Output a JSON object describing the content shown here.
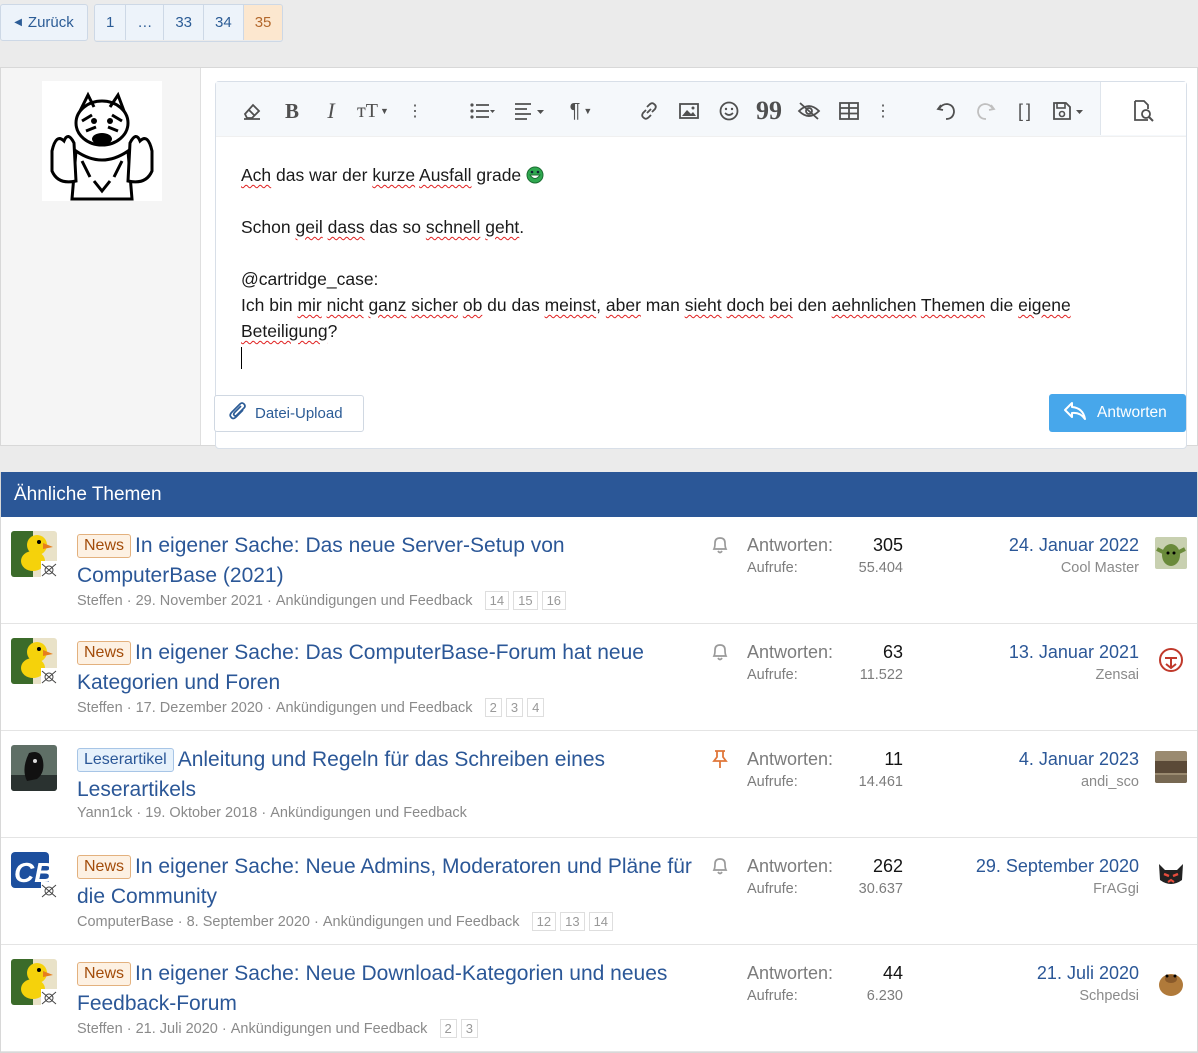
{
  "pagination": {
    "back_label": "Zurück",
    "pages": [
      "1",
      "…",
      "33",
      "34",
      "35"
    ],
    "current": "35"
  },
  "editor": {
    "lines": [
      {
        "words": [
          {
            "t": "Ach",
            "sq": true
          },
          {
            "t": " das war der "
          },
          {
            "t": "kurze",
            "sq": true
          },
          {
            "t": " "
          },
          {
            "t": "Ausfall",
            "sq": true
          },
          {
            "t": " grade "
          }
        ],
        "emoji": true
      },
      {
        "words": []
      },
      {
        "words": [
          {
            "t": "Schon "
          },
          {
            "t": "geil",
            "sq": true
          },
          {
            "t": " "
          },
          {
            "t": "dass",
            "sq": true
          },
          {
            "t": " das so "
          },
          {
            "t": "schnell",
            "sq": true
          },
          {
            "t": " "
          },
          {
            "t": "geht",
            "sq": true
          },
          {
            "t": "."
          }
        ]
      },
      {
        "words": []
      },
      {
        "words": [
          {
            "t": "@cartridge_case:"
          }
        ]
      },
      {
        "words": [
          {
            "t": "Ich bin "
          },
          {
            "t": "mir",
            "sq": true
          },
          {
            "t": " "
          },
          {
            "t": "nicht",
            "sq": true
          },
          {
            "t": " "
          },
          {
            "t": "ganz",
            "sq": true
          },
          {
            "t": " "
          },
          {
            "t": "sicher",
            "sq": true
          },
          {
            "t": " "
          },
          {
            "t": "ob",
            "sq": true
          },
          {
            "t": " du das "
          },
          {
            "t": "meinst",
            "sq": true
          },
          {
            "t": ", "
          },
          {
            "t": "aber",
            "sq": true
          },
          {
            "t": " man "
          },
          {
            "t": "sieht",
            "sq": true
          },
          {
            "t": " "
          },
          {
            "t": "doch",
            "sq": true
          },
          {
            "t": " "
          },
          {
            "t": "bei",
            "sq": true
          },
          {
            "t": " den "
          },
          {
            "t": "aehnlichen",
            "sq": true
          },
          {
            "t": " "
          },
          {
            "t": "Themen",
            "sq": true
          },
          {
            "t": " die "
          },
          {
            "t": "eigene",
            "sq": true
          },
          {
            "t": " "
          },
          {
            "t": "Beteiligung",
            "sq": true
          },
          {
            "t": "?"
          }
        ]
      }
    ]
  },
  "buttons": {
    "upload": "Datei-Upload",
    "answer": "Antworten"
  },
  "similar": {
    "heading": "Ähnliche Themen",
    "threads": [
      {
        "label": "News",
        "label_type": "news",
        "title": "In eigener Sache: Das neue Server-Setup von ComputerBase (2021)",
        "author": "Steffen",
        "date": "29. November 2021",
        "forum": "Ankündigungen und Feedback",
        "pages": [
          "14",
          "15",
          "16"
        ],
        "status_icon": "bell-icon",
        "replies_label": "Antworten:",
        "replies": "305",
        "views_label": "Aufrufe:",
        "views": "55.404",
        "last_date": "24. Januar 2022",
        "last_user": "Cool Master",
        "avatar": "duck",
        "last_avatar": "yoda"
      },
      {
        "label": "News",
        "label_type": "news",
        "title": "In eigener Sache: Das ComputerBase-Forum hat neue Kategorien und Foren",
        "author": "Steffen",
        "date": "17. Dezember 2020",
        "forum": "Ankündigungen und Feedback",
        "pages": [
          "2",
          "3",
          "4"
        ],
        "status_icon": "bell-icon",
        "replies_label": "Antworten:",
        "replies": "63",
        "views_label": "Aufrufe:",
        "views": "11.522",
        "last_date": "13. Januar 2021",
        "last_user": "Zensai",
        "avatar": "duck",
        "last_avatar": "trooper"
      },
      {
        "label": "Leserartikel",
        "label_type": "leser",
        "title": "Anleitung und Regeln für das Schreiben eines Leserartikels",
        "author": "Yann1ck",
        "date": "19. Oktober 2018",
        "forum": "Ankündigungen und Feedback",
        "pages": [],
        "status_icon": "pin-icon",
        "replies_label": "Antworten:",
        "replies": "11",
        "views_label": "Aufrufe:",
        "views": "14.461",
        "last_date": "4. Januar 2023",
        "last_user": "andi_sco",
        "avatar": "dark",
        "last_avatar": "stone"
      },
      {
        "label": "News",
        "label_type": "news",
        "title": "In eigener Sache: Neue Admins, Moderatoren und Pläne für die Community",
        "author": "ComputerBase",
        "date": "8. September 2020",
        "forum": "Ankündigungen und Feedback",
        "pages": [
          "12",
          "13",
          "14"
        ],
        "status_icon": "bell-icon",
        "replies_label": "Antworten:",
        "replies": "262",
        "views_label": "Aufrufe:",
        "views": "30.637",
        "last_date": "29. September 2020",
        "last_user": "FrAGgi",
        "avatar": "cb",
        "last_avatar": "cat"
      },
      {
        "label": "News",
        "label_type": "news",
        "title": "In eigener Sache: Neue Download-Kategorien und neues Feedback-Forum",
        "author": "Steffen",
        "date": "21. Juli 2020",
        "forum": "Ankündigungen und Feedback",
        "pages": [
          "2",
          "3"
        ],
        "status_icon": "",
        "replies_label": "Antworten:",
        "replies": "44",
        "views_label": "Aufrufe:",
        "views": "6.230",
        "last_date": "21. Juli 2020",
        "last_user": "Schpedsi",
        "avatar": "duck",
        "last_avatar": "alf"
      }
    ]
  }
}
